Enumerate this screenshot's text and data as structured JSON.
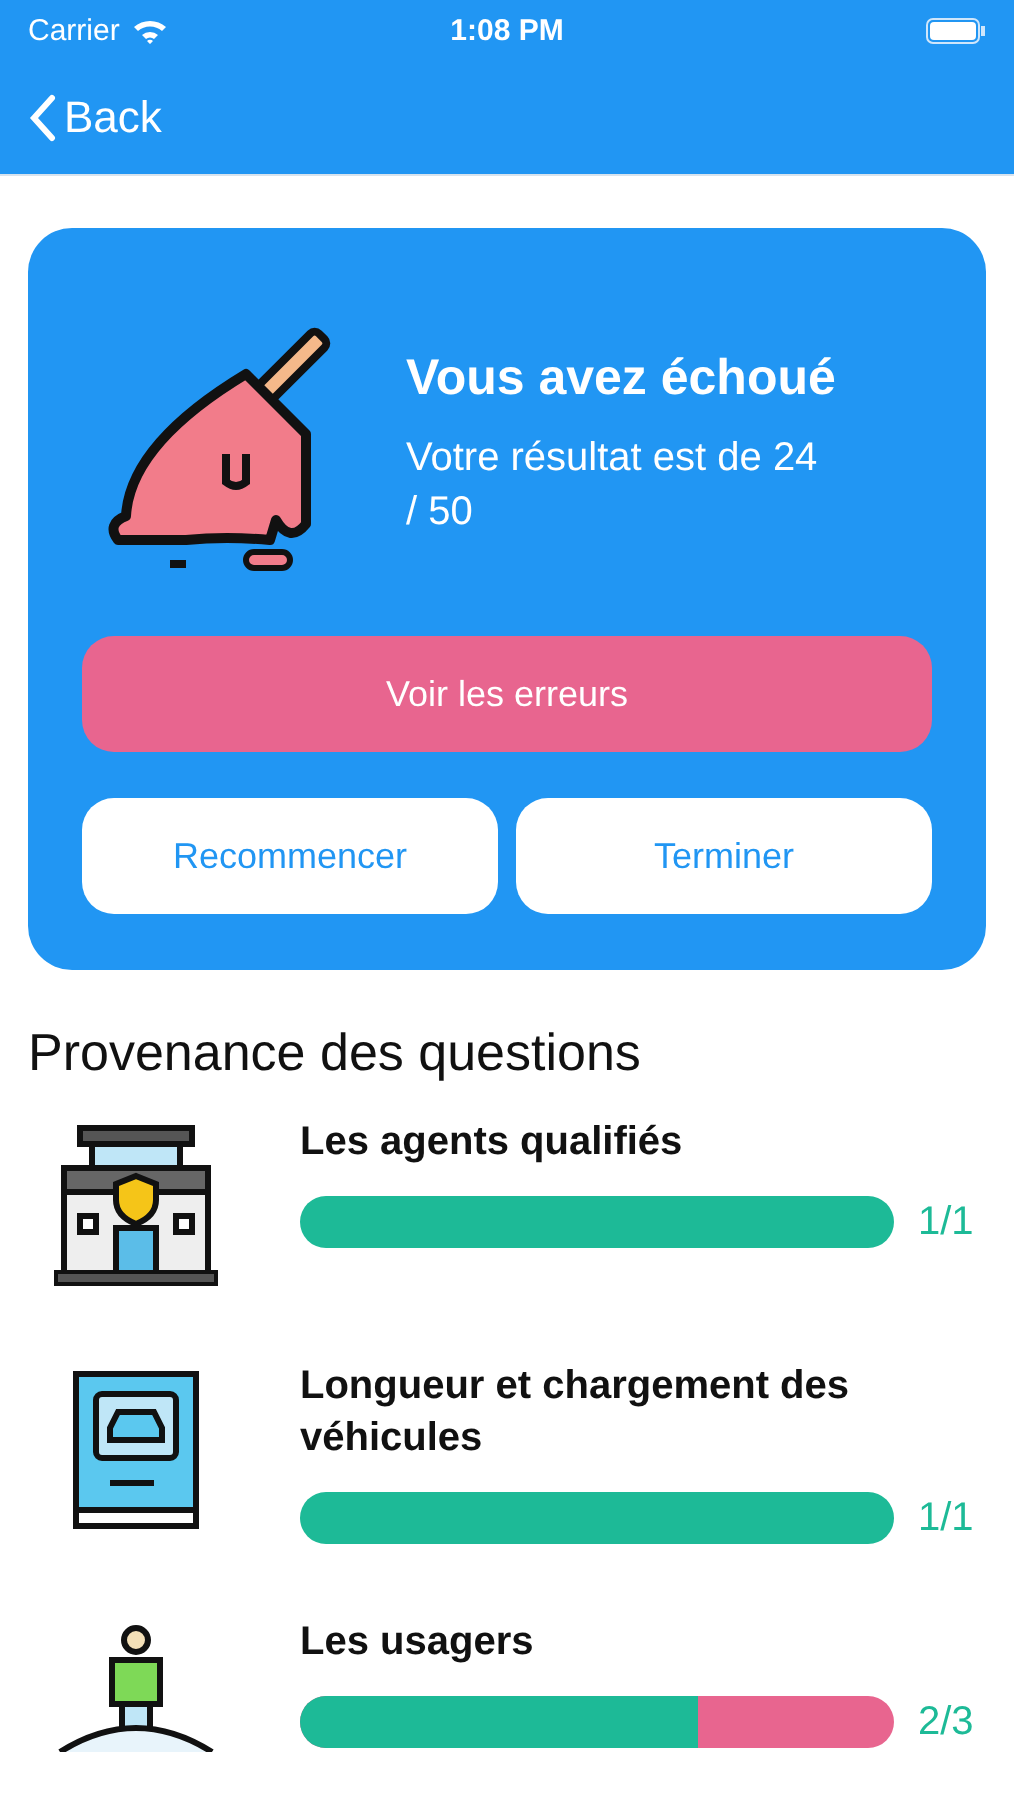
{
  "status_bar": {
    "carrier": "Carrier",
    "time": "1:08 PM"
  },
  "nav": {
    "back": "Back"
  },
  "result": {
    "title": "Vous avez échoué",
    "text": "Votre résultat est de 24 / 50",
    "buttons": [
      {
        "label": "Voir les erreurs",
        "kind": "primary"
      },
      {
        "label": "Recommencer",
        "kind": "secondary"
      },
      {
        "label": "Terminer",
        "kind": "secondary"
      }
    ]
  },
  "section_title": "Provenance des questions",
  "categories": [
    {
      "name": "Les agents qualifiés",
      "kind": "building",
      "level": 1,
      "score": "1/1"
    },
    {
      "name": "Longueur et chargement des véhicules",
      "kind": "book",
      "level": 1,
      "score": "1/1"
    },
    {
      "name": "Les usagers",
      "kind": "person",
      "level": 0.67,
      "score": "2/3"
    }
  ]
}
